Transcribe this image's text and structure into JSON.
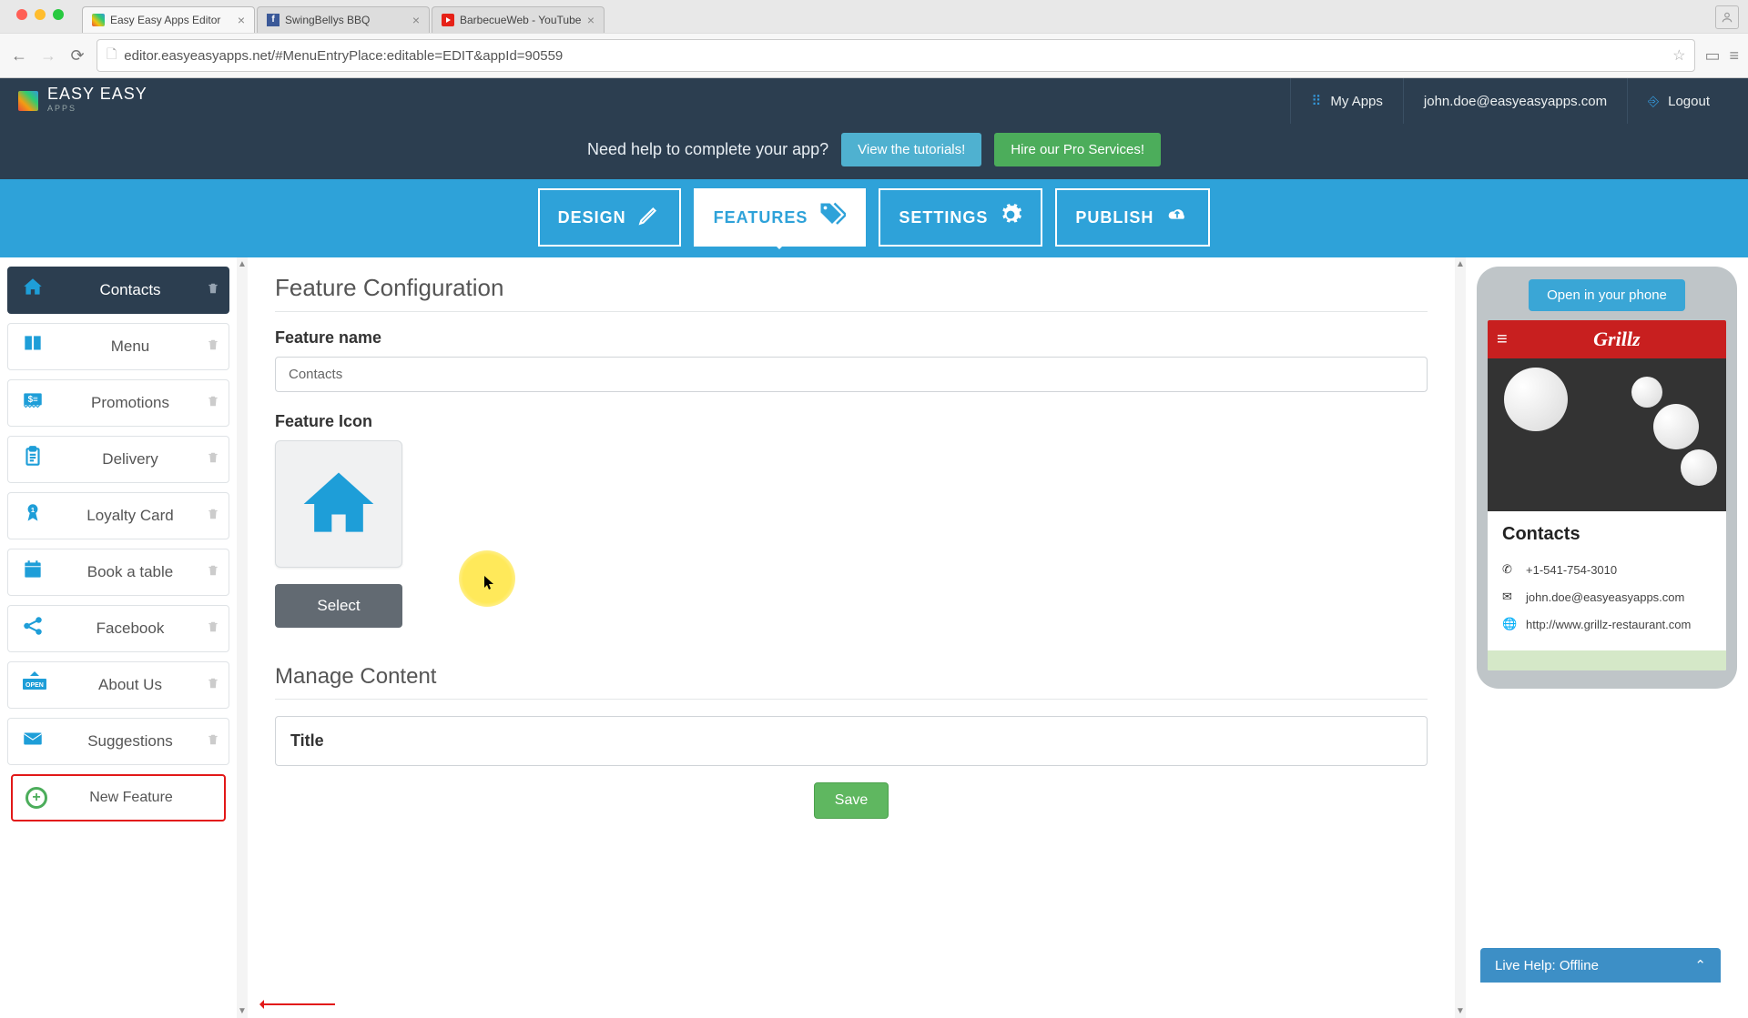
{
  "browser": {
    "tabs": [
      {
        "title": "Easy Easy Apps Editor",
        "active": true
      },
      {
        "title": "SwingBellys BBQ",
        "active": false
      },
      {
        "title": "BarbecueWeb - YouTube",
        "active": false
      }
    ],
    "url": "editor.easyeasyapps.net/#MenuEntryPlace:editable=EDIT&appId=90559"
  },
  "header": {
    "brand_line1": "EASY EASY",
    "brand_line2": "APPS",
    "my_apps": "My Apps",
    "email": "john.doe@easyeasyapps.com",
    "logout": "Logout"
  },
  "help_bar": {
    "prompt": "Need help to complete your app?",
    "tutorials_btn": "View the tutorials!",
    "pro_btn": "Hire our Pro Services!"
  },
  "main_tabs": {
    "design": "DESIGN",
    "features": "FEATURES",
    "settings": "SETTINGS",
    "publish": "PUBLISH"
  },
  "sidebar": {
    "items": [
      {
        "label": "Contacts",
        "icon": "home"
      },
      {
        "label": "Menu",
        "icon": "book"
      },
      {
        "label": "Promotions",
        "icon": "dollar"
      },
      {
        "label": "Delivery",
        "icon": "clipboard"
      },
      {
        "label": "Loyalty Card",
        "icon": "ribbon"
      },
      {
        "label": "Book a table",
        "icon": "calendar"
      },
      {
        "label": "Facebook",
        "icon": "share"
      },
      {
        "label": "About Us",
        "icon": "open"
      },
      {
        "label": "Suggestions",
        "icon": "mail"
      }
    ],
    "new_feature": "New Feature"
  },
  "config": {
    "heading": "Feature Configuration",
    "name_label": "Feature name",
    "name_value": "Contacts",
    "icon_label": "Feature Icon",
    "select_btn": "Select",
    "manage_heading": "Manage Content",
    "title_label": "Title",
    "save_btn": "Save"
  },
  "preview": {
    "open_btn": "Open in your phone",
    "app_title": "Grillz",
    "screen_heading": "Contacts",
    "phone": "+1-541-754-3010",
    "email": "john.doe@easyeasyapps.com",
    "website": "http://www.grillz-restaurant.com"
  },
  "live_help": "Live Help: Offline"
}
